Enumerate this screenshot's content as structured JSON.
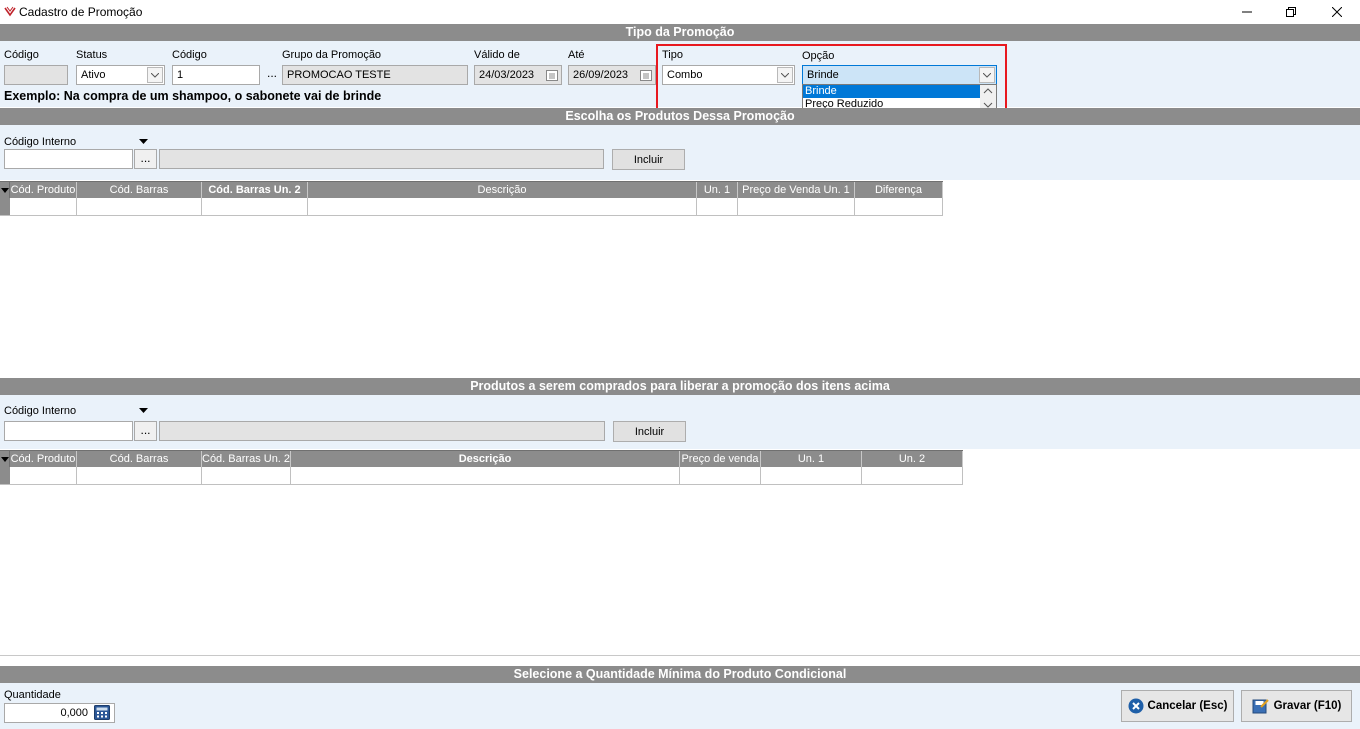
{
  "window": {
    "title": "Cadastro de Promoção"
  },
  "sections": {
    "tipo_header": "Tipo da Promoção",
    "escolha_header": "Escolha os Produtos Dessa Promoção",
    "produtos_header": "Produtos a serem comprados para liberar a promoção dos itens acima",
    "quantidade_header": "Selecione a Quantidade Mínima do Produto Condicional"
  },
  "promo": {
    "codigo_label": "Código",
    "codigo_value": "",
    "status_label": "Status",
    "status_value": "Ativo",
    "codigo2_label": "Código",
    "codigo2_value": "1",
    "ellipsis": "...",
    "grupo_label": "Grupo da Promoção",
    "grupo_value": "PROMOCAO TESTE",
    "valido_label": "Válido de",
    "valido_value": "24/03/2023",
    "ate_label": "Até",
    "ate_value": "26/09/2023",
    "tipo_label": "Tipo",
    "tipo_value": "Combo",
    "opcao_label": "Opção",
    "opcao_value": "Brinde",
    "opcao_options": [
      "Brinde",
      "Preço Reduzido"
    ],
    "example_text": "Exemplo: Na compra de um shampoo, o sabonete vai de brinde"
  },
  "escolha": {
    "codigo_interno_label": "Código Interno",
    "input_value": "",
    "ellipsis": "...",
    "incluir_label": "Incluir",
    "columns": [
      "Cód. Produto",
      "Cód. Barras",
      "Cód. Barras Un. 2",
      "Descrição",
      "Un. 1",
      "Preço de Venda Un. 1",
      "Diferença"
    ]
  },
  "produtos": {
    "codigo_interno_label": "Código Interno",
    "input_value": "",
    "ellipsis": "...",
    "incluir_label": "Incluir",
    "columns": [
      "Cód. Produto",
      "Cód. Barras",
      "Cód. Barras Un. 2",
      "Descrição",
      "Preço de venda",
      "Un. 1",
      "Un. 2"
    ]
  },
  "quantidade": {
    "label": "Quantidade",
    "value": "0,000"
  },
  "buttons": {
    "cancelar": "Cancelar (Esc)",
    "gravar": "Gravar (F10)"
  }
}
